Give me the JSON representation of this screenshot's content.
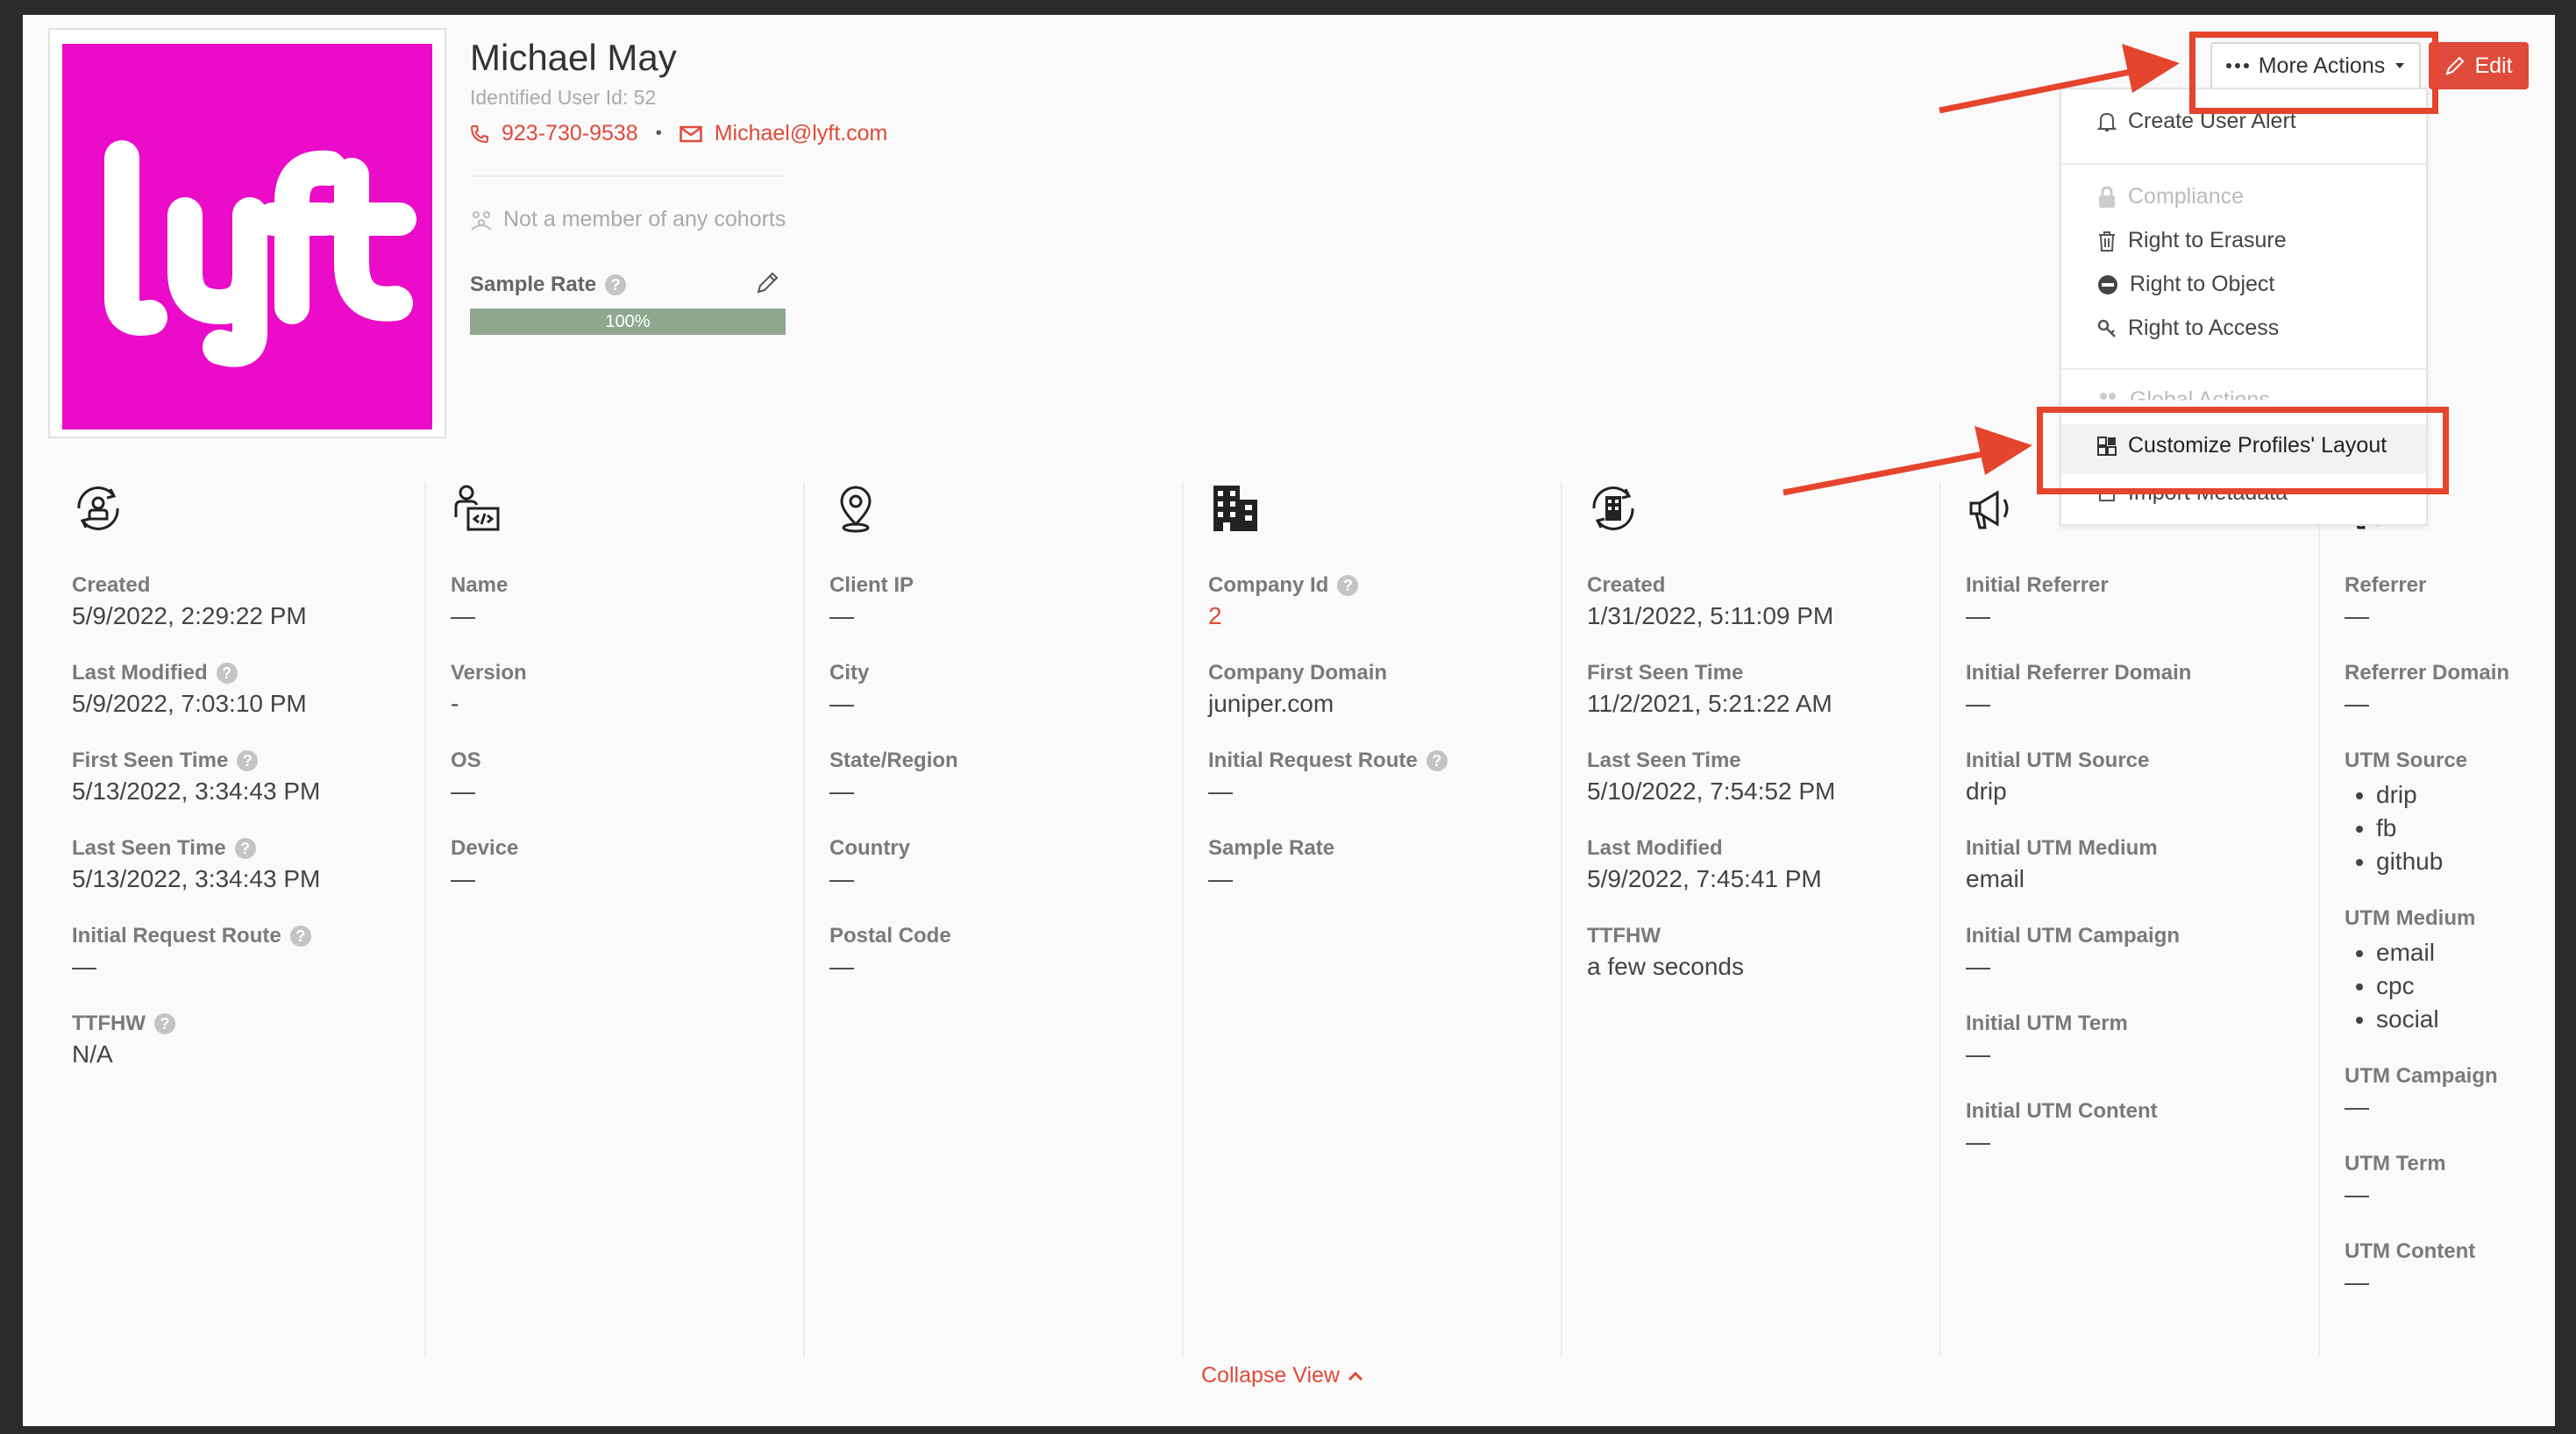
{
  "user": {
    "name": "Michael May",
    "identified_id": "Identified User Id: 52",
    "phone": "923-730-9538",
    "email": "Michael@lyft.com",
    "contact_separator": "•",
    "cohort": "Not a member of any cohorts",
    "logo_text": "lyft",
    "logo_color": "#ea0cc8"
  },
  "sample_rate": {
    "label": "Sample Rate",
    "help": "?",
    "value_label": "100%",
    "value": 1.0
  },
  "header": {
    "more_actions": "More Actions",
    "edit": "Edit"
  },
  "menu": {
    "create_alert": "Create User Alert",
    "compliance": "Compliance",
    "erasure": "Right to Erasure",
    "object": "Right to Object",
    "access": "Right to Access",
    "global_actions": "Global Actions",
    "customize": "Customize Profiles' Layout",
    "import": "Import Metadata"
  },
  "columns": [
    {
      "icon": "user-cycle-icon",
      "fields": [
        {
          "label": "Created",
          "value": "5/9/2022, 2:29:22 PM"
        },
        {
          "label": "Last Modified",
          "help": "?",
          "value": "5/9/2022, 7:03:10 PM"
        },
        {
          "label": "First Seen Time",
          "help": "?",
          "value": "5/13/2022, 3:34:43 PM"
        },
        {
          "label": "Last Seen Time",
          "help": "?",
          "value": "5/13/2022, 3:34:43 PM"
        },
        {
          "label": "Initial Request Route",
          "help": "?",
          "value": "—"
        },
        {
          "label": "TTFHW",
          "help": "?",
          "value": "N/A"
        }
      ]
    },
    {
      "icon": "developer-icon",
      "fields": [
        {
          "label": "Name",
          "value": "—"
        },
        {
          "label": "Version",
          "value": "-"
        },
        {
          "label": "OS",
          "value": "—"
        },
        {
          "label": "Device",
          "value": "—"
        }
      ]
    },
    {
      "icon": "location-pin-icon",
      "fields": [
        {
          "label": "Client IP",
          "value": "—"
        },
        {
          "label": "City",
          "value": "—"
        },
        {
          "label": "State/Region",
          "value": "—"
        },
        {
          "label": "Country",
          "value": "—"
        },
        {
          "label": "Postal Code",
          "value": "—"
        }
      ]
    },
    {
      "icon": "building-icon",
      "fields": [
        {
          "label": "Company Id",
          "help": "?",
          "value": "2",
          "red": true
        },
        {
          "label": "Company Domain",
          "value": "juniper.com"
        },
        {
          "label": "Initial Request Route",
          "help": "?",
          "value": "—"
        },
        {
          "label": "Sample Rate",
          "value": "—"
        }
      ]
    },
    {
      "icon": "company-cycle-icon",
      "fields": [
        {
          "label": "Created",
          "value": "1/31/2022, 5:11:09 PM"
        },
        {
          "label": "First Seen Time",
          "value": "11/2/2021, 5:21:22 AM"
        },
        {
          "label": "Last Seen Time",
          "value": "5/10/2022, 7:54:52 PM"
        },
        {
          "label": "Last Modified",
          "value": "5/9/2022, 7:45:41 PM"
        },
        {
          "label": "TTFHW",
          "value": "a few seconds"
        }
      ]
    },
    {
      "icon": "megaphone-icon",
      "fields": [
        {
          "label": "Initial Referrer",
          "value": "—"
        },
        {
          "label": "Initial Referrer Domain",
          "value": "—"
        },
        {
          "label": "Initial UTM Source",
          "value": "drip"
        },
        {
          "label": "Initial UTM Medium",
          "value": "email"
        },
        {
          "label": "Initial UTM Campaign",
          "value": "—"
        },
        {
          "label": "Initial UTM Term",
          "value": "—"
        },
        {
          "label": "Initial UTM Content",
          "value": "—"
        }
      ]
    },
    {
      "icon": "megaphone-icon",
      "fields": [
        {
          "label": "Referrer",
          "value": "—"
        },
        {
          "label": "Referrer Domain",
          "value": "—"
        },
        {
          "label": "UTM Source",
          "list": [
            "drip",
            "fb",
            "github"
          ]
        },
        {
          "label": "UTM Medium",
          "list": [
            "email",
            "cpc",
            "social"
          ]
        },
        {
          "label": "UTM Campaign",
          "value": "—"
        },
        {
          "label": "UTM Term",
          "value": "—"
        },
        {
          "label": "UTM Content",
          "value": "—"
        }
      ]
    }
  ],
  "footer": {
    "collapse": "Collapse View"
  },
  "colors": {
    "accent": "#e04a3a",
    "annotation": "#e5442d",
    "progress": "#8fa88f"
  }
}
